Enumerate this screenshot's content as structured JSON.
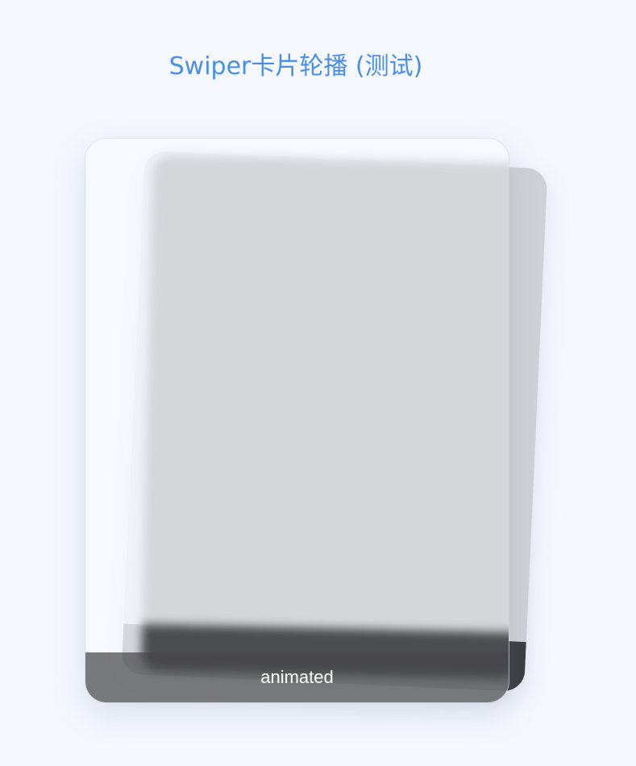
{
  "header": {
    "title": "Swiper卡片轮播 (测试)"
  },
  "carousel": {
    "active_slide": {
      "caption": "animated"
    }
  }
}
